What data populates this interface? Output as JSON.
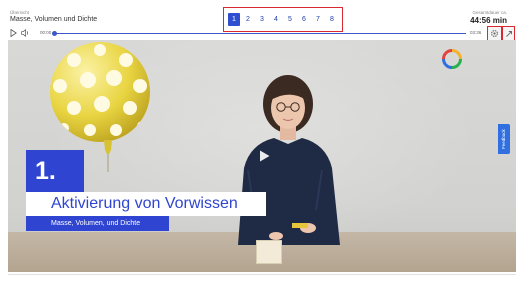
{
  "header": {
    "crumb_label": "Übersicht",
    "course_title": "Masse, Volumen und Dichte",
    "time_label": "Gesamtdauer ca.",
    "time_value": "44:56 min"
  },
  "pagination": {
    "pages": [
      "1",
      "2",
      "3",
      "4",
      "5",
      "6",
      "7",
      "8"
    ],
    "active": "1"
  },
  "player": {
    "time_start": "00:00",
    "time_end": "03:36",
    "progress": 0.0,
    "play_icon": "play-icon",
    "volume_icon": "volume-icon",
    "settings_icon": "settings-icon",
    "expand_icon": "expand-icon"
  },
  "video": {
    "number": "1.",
    "title": "Aktivierung von Vorwissen",
    "subtitle": "Masse, Volumen, und Dichte",
    "feedback_label": "Feedback",
    "center_play_icon": "play-icon"
  },
  "colors": {
    "accent": "#2f45d1",
    "highlight_border": "#d9282f",
    "balloon": "#e9d542"
  }
}
